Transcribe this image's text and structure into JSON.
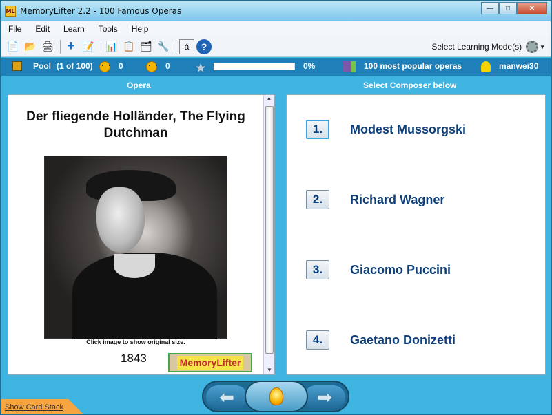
{
  "window": {
    "title": "MemoryLifter 2.2 - 100 Famous Operas",
    "app_icon": "ML"
  },
  "menu": [
    "File",
    "Edit",
    "Learn",
    "Tools",
    "Help"
  ],
  "toolbar": {
    "mode_label": "Select Learning Mode(s)"
  },
  "status": {
    "pool_label": "Pool",
    "pool_count": "(1 of 100)",
    "right_count": "0",
    "wrong_count": "0",
    "progress": "0%",
    "progress_value": 0,
    "learning_module": "100 most popular operas",
    "user": "manwei30"
  },
  "headers": {
    "left": "Opera",
    "right": "Select Composer below"
  },
  "card": {
    "question": "Der fliegende Holländer, The Flying Dutchman",
    "caption": "Click image to show original size.",
    "year": "1843",
    "logo_text": "MemoryLifter"
  },
  "answers": [
    {
      "num": "1.",
      "text": "Modest Mussorgski"
    },
    {
      "num": "2.",
      "text": "Richard Wagner"
    },
    {
      "num": "3.",
      "text": "Giacomo Puccini"
    },
    {
      "num": "4.",
      "text": "Gaetano Donizetti"
    }
  ],
  "footer": {
    "show_stack": "Show Card Stack"
  },
  "colors": {
    "accent": "#1f7fb8",
    "answer_text": "#0d3f78"
  }
}
